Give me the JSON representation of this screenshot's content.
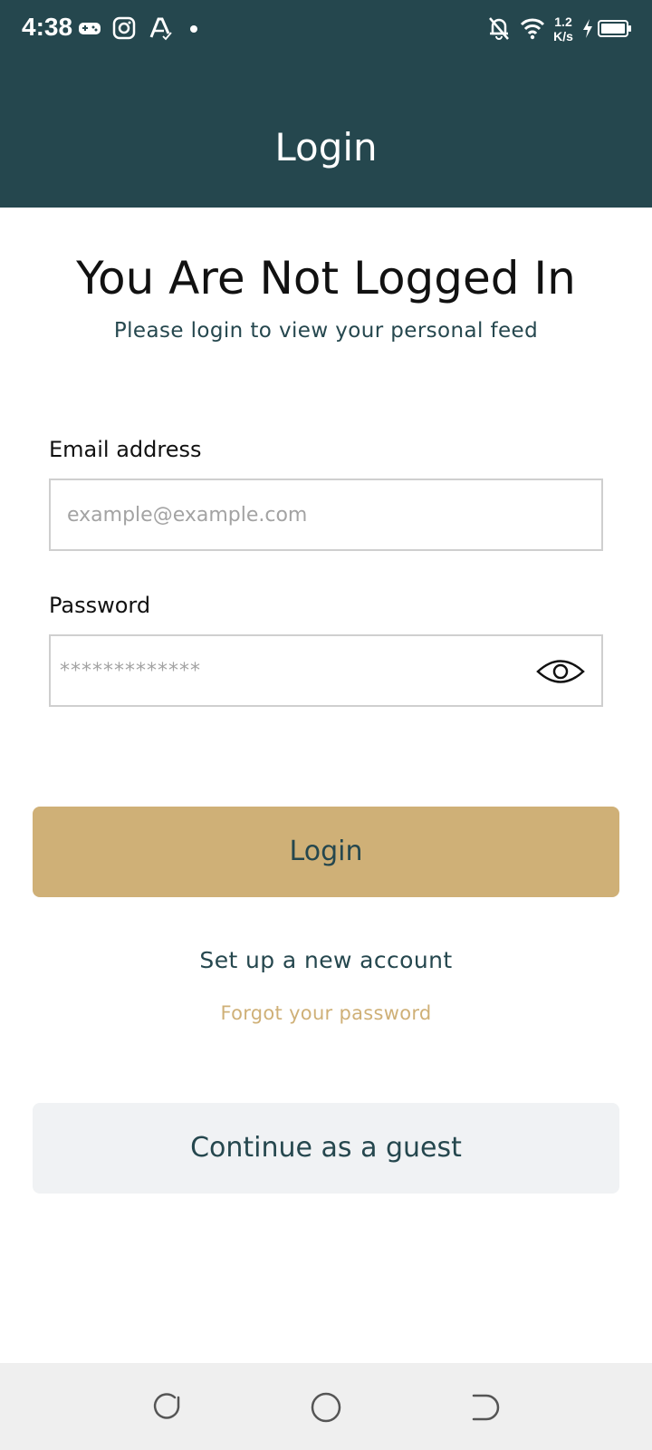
{
  "status_bar": {
    "time": "4:38",
    "network_speed_value": "1.2",
    "network_speed_unit": "K/s",
    "icons": [
      "game-icon",
      "instagram-icon",
      "font-app-icon",
      "notification-dot-icon",
      "bell-off-icon",
      "wifi-icon",
      "charging-icon",
      "battery-icon"
    ]
  },
  "header": {
    "title": "Login"
  },
  "main": {
    "title": "You Are Not Logged In",
    "subtitle": "Please login to view your personal feed"
  },
  "form": {
    "email_label": "Email address",
    "email_placeholder": "example@example.com",
    "password_label": "Password",
    "password_placeholder": "*************",
    "login_button": "Login",
    "setup_link": "Set up a new account",
    "forgot_link": "Forgot your password",
    "guest_button": "Continue as a guest"
  },
  "colors": {
    "header_bg": "#25474e",
    "accent_gold": "#cfb077",
    "guest_bg": "#f0f2f4",
    "nav_bg": "#efefef"
  }
}
